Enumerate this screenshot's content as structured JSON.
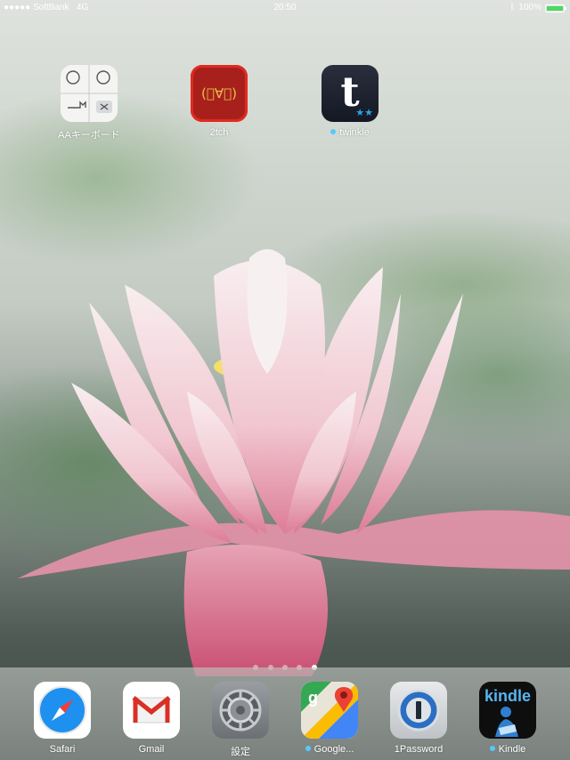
{
  "status_bar": {
    "signal": "●●●●●",
    "carrier": "SoftBank",
    "network": "4G",
    "time": "20:50",
    "battery_percent": "100%",
    "battery_level": 1.0,
    "battery_color": "#4cd964"
  },
  "home_apps": [
    {
      "label": "AAキーボード",
      "icon": "aa-keyboard-icon",
      "badge_dot": false
    },
    {
      "label": "2tch",
      "icon": "2tch-icon",
      "face": "(ﾟ∀ﾟ)",
      "badge_dot": false
    },
    {
      "label": "twinkle",
      "icon": "twinkle-icon",
      "glyph": "t",
      "badge_dot": true
    }
  ],
  "page_indicator": {
    "count": 5,
    "current": 5
  },
  "dock_apps": [
    {
      "label": "Safari",
      "icon": "safari-icon",
      "badge_dot": false
    },
    {
      "label": "Gmail",
      "icon": "gmail-icon",
      "badge_dot": false
    },
    {
      "label": "設定",
      "icon": "settings-icon",
      "badge_dot": false
    },
    {
      "label": "Google...",
      "icon": "google-maps-icon",
      "badge_dot": true
    },
    {
      "label": "1Password",
      "icon": "onepassword-icon",
      "badge_dot": false
    },
    {
      "label": "Kindle",
      "icon": "kindle-icon",
      "glyph": "kindle",
      "badge_dot": true
    }
  ],
  "colors": {
    "new_app_dot": "#5ac8fa",
    "2tch_red": "#b0201a",
    "twinkle_dark": "#1b1f2b"
  }
}
